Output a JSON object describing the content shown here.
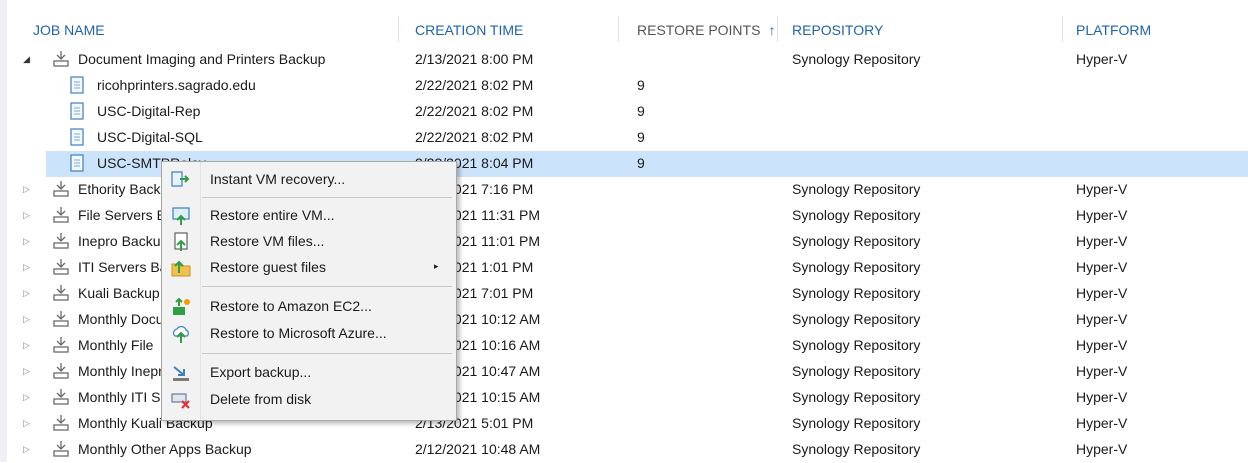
{
  "columns": {
    "job_name": "JOB NAME",
    "creation_time": "CREATION TIME",
    "restore_points": "RESTORE POINTS",
    "restore_points_sort_arrow": "↑",
    "repository": "REPOSITORY",
    "platform": "PLATFORM"
  },
  "rows": [
    {
      "expander": "◢",
      "name": "Document Imaging and Printers Backup",
      "time": "2/13/2021 8:00 PM",
      "points": "",
      "repo": "Synology Repository",
      "platform": "Hyper-V"
    },
    {
      "name": "ricohprinters.sagrado.edu",
      "time": "2/22/2021 8:02 PM",
      "points": "9"
    },
    {
      "name": "USC-Digital-Rep",
      "time": "2/22/2021 8:02 PM",
      "points": "9"
    },
    {
      "name": "USC-Digital-SQL",
      "time": "2/22/2021 8:02 PM",
      "points": "9"
    },
    {
      "name": "USC-SMTPRelay",
      "time": "2/22/2021 8:04 PM",
      "points": "9"
    },
    {
      "expander": "▷",
      "name": "Ethority Backup",
      "time": "2/13/2021 7:16 PM",
      "points": "",
      "repo": "Synology Repository",
      "platform": "Hyper-V"
    },
    {
      "expander": "▷",
      "name": "File Servers Backup",
      "time": "2/13/2021 11:31 PM",
      "points": "",
      "repo": "Synology Repository",
      "platform": "Hyper-V"
    },
    {
      "expander": "▷",
      "name": "Inepro Backup",
      "time": "2/13/2021 11:01 PM",
      "points": "",
      "repo": "Synology Repository",
      "platform": "Hyper-V"
    },
    {
      "expander": "▷",
      "name": "ITI Servers Backup",
      "time": "2/13/2021 1:01 PM",
      "points": "",
      "repo": "Synology Repository",
      "platform": "Hyper-V"
    },
    {
      "expander": "▷",
      "name": "Kuali Backup",
      "time": "2/13/2021 7:01 PM",
      "points": "",
      "repo": "Synology Repository",
      "platform": "Hyper-V"
    },
    {
      "expander": "▷",
      "name": "Monthly Document",
      "time": "2/13/2021 10:12 AM",
      "points": "",
      "repo": "Synology Repository",
      "platform": "Hyper-V"
    },
    {
      "expander": "▷",
      "name": "Monthly File",
      "time": "2/13/2021 10:16 AM",
      "points": "",
      "repo": "Synology Repository",
      "platform": "Hyper-V"
    },
    {
      "expander": "▷",
      "name": "Monthly Inepro",
      "time": "2/13/2021 10:47 AM",
      "points": "",
      "repo": "Synology Repository",
      "platform": "Hyper-V"
    },
    {
      "expander": "▷",
      "name": "Monthly ITI Servers",
      "time": "2/13/2021 10:15 AM",
      "points": "",
      "repo": "Synology Repository",
      "platform": "Hyper-V"
    },
    {
      "expander": "▷",
      "name": "Monthly Kuali Backup",
      "time": "2/13/2021 5:01 PM",
      "points": "",
      "repo": "Synology Repository",
      "platform": "Hyper-V"
    },
    {
      "expander": "▷",
      "name": "Monthly Other Apps Backup",
      "time": "2/12/2021 10:48 AM",
      "points": "",
      "repo": "Synology Repository",
      "platform": "Hyper-V"
    }
  ],
  "context_menu": {
    "instant_vm_recovery": "Instant VM recovery...",
    "restore_entire_vm": "Restore entire VM...",
    "restore_vm_files": "Restore VM files...",
    "restore_guest_files": "Restore guest files",
    "submenu_arrow": "▸",
    "restore_to_amazon_ec2": "Restore to Amazon EC2...",
    "restore_to_microsoft_azure": "Restore to Microsoft Azure...",
    "export_backup": "Export backup...",
    "delete_from_disk": "Delete from disk"
  },
  "icons": {
    "job": "backup-job-icon",
    "vm": "vm-document-icon"
  },
  "colors": {
    "header_text": "#1e63b0",
    "selection": "#cce4fb",
    "menu_bg": "#f2f2f2"
  }
}
